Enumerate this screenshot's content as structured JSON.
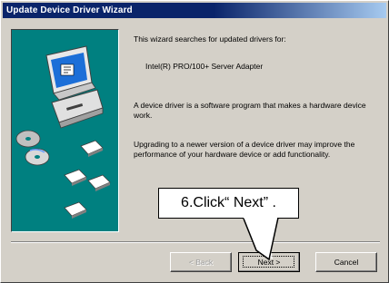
{
  "window": {
    "title": "Update Device Driver Wizard"
  },
  "content": {
    "intro": "This wizard searches for updated drivers for:",
    "device_name": "Intel(R) PRO/100+ Server Adapter",
    "description": "A device driver is a software program that makes a hardware device work.",
    "upgrade_info": "Upgrading to a newer version of a device driver may improve the performance of your hardware device or add functionality."
  },
  "buttons": {
    "back": "< Back",
    "next": "Next >",
    "cancel": "Cancel"
  },
  "annotation": {
    "callout_text": "6.Click“ Next” ."
  },
  "colors": {
    "titlebar": "#0a246a",
    "graphic_panel": "#008080",
    "dialog_face": "#d4d0c8"
  },
  "icons": [
    "computer-icon",
    "cd-disc-icon",
    "floppy-disk-icon"
  ]
}
